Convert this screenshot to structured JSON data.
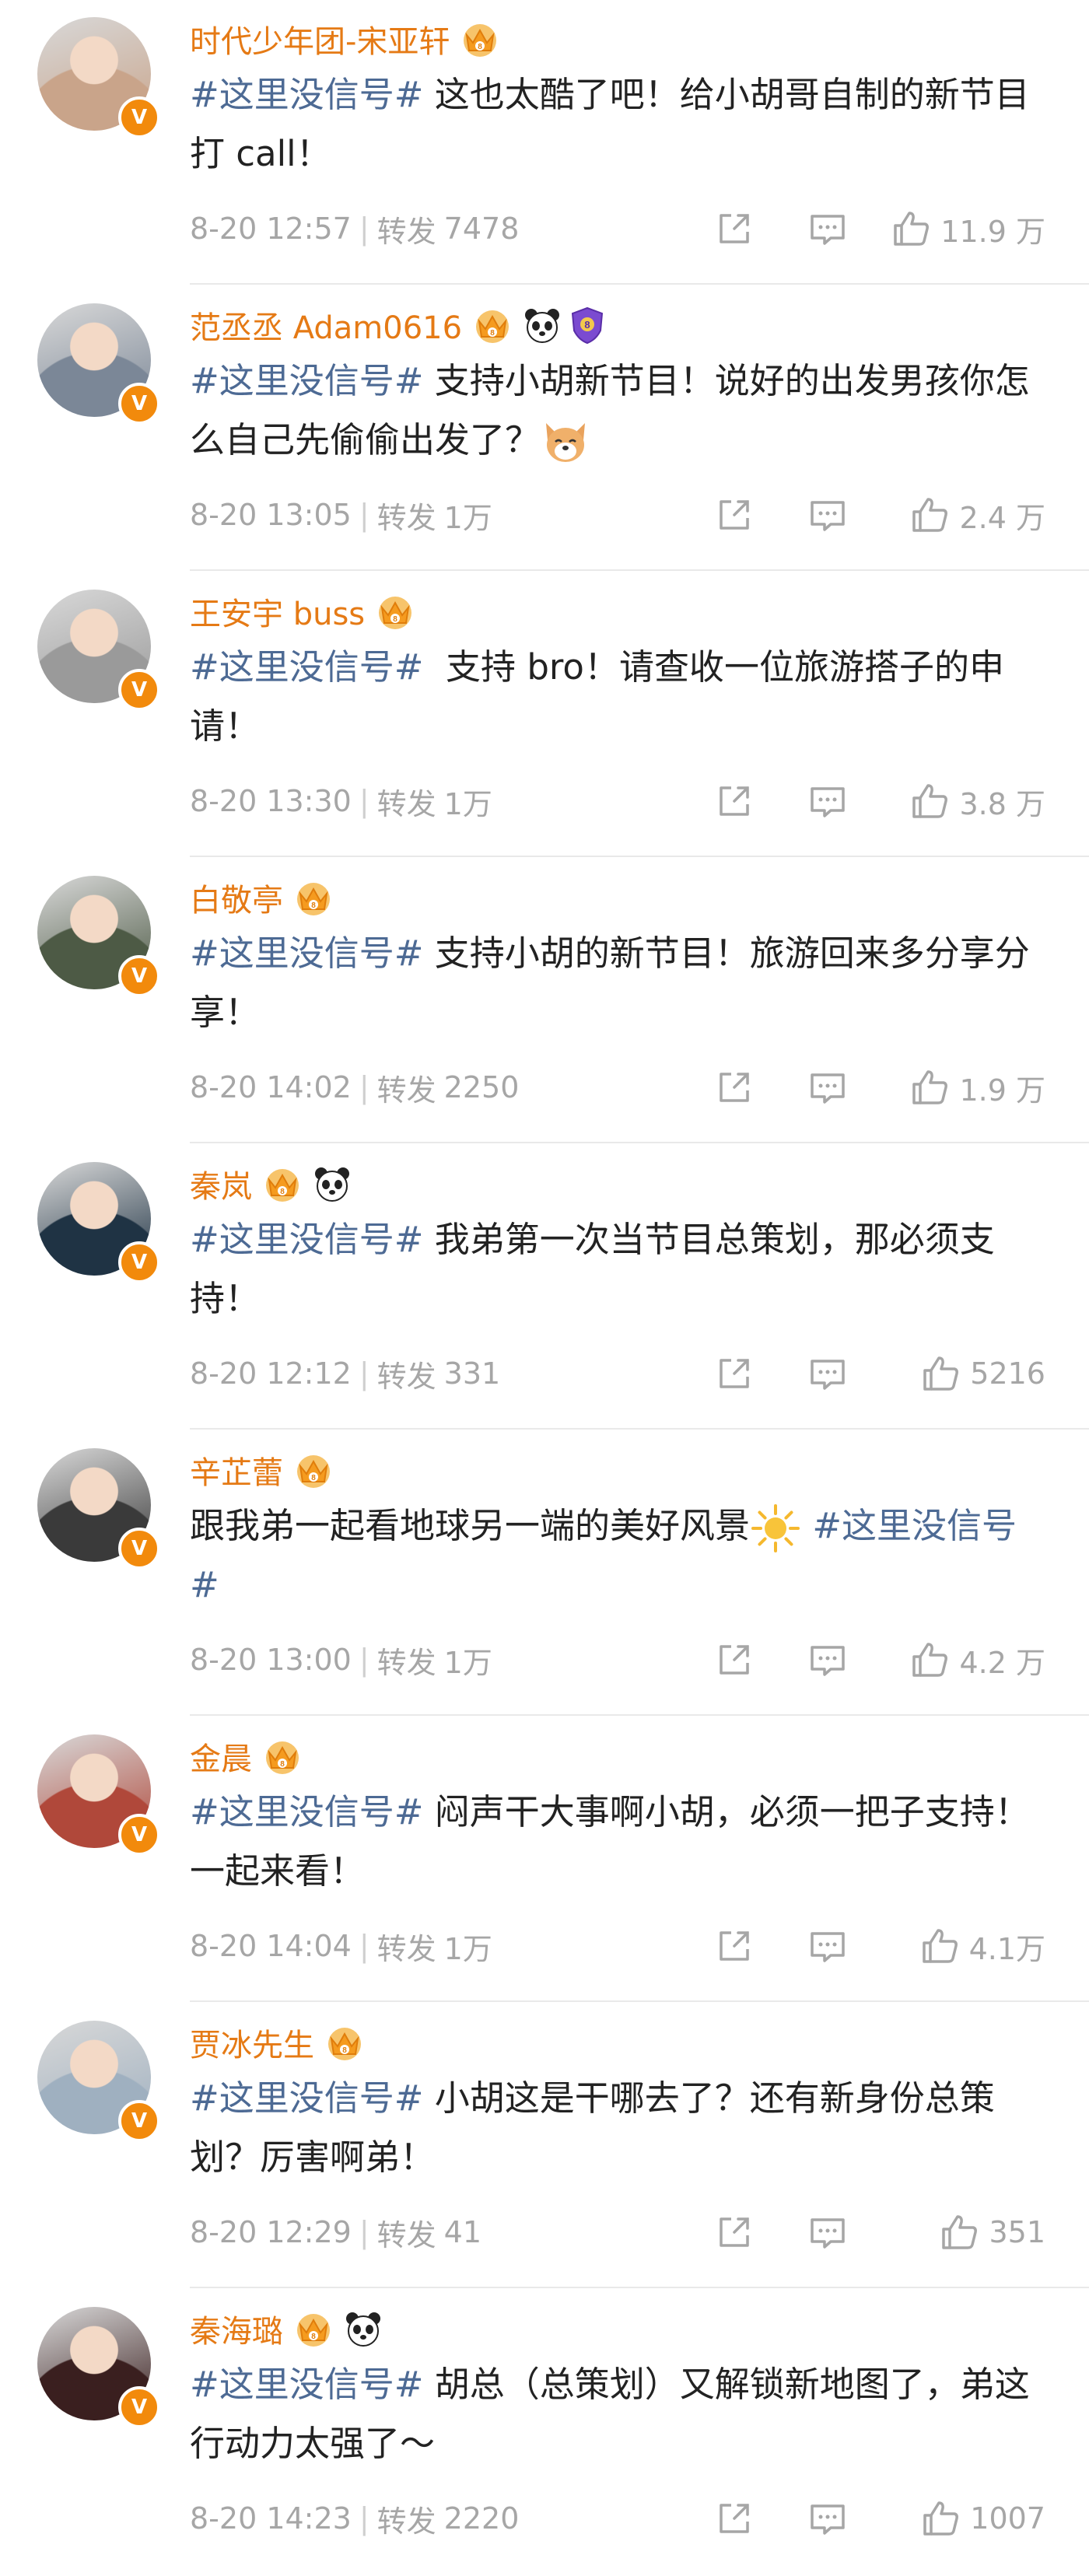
{
  "posts": [
    {
      "name": "时代少年团-宋亚轩",
      "badges": [
        "crown"
      ],
      "topic": "#这里没信号#",
      "body": " 这也太酷了吧！给小胡哥自制的新节目打 call！",
      "time": "8-20 12:57",
      "repost_label": "转发",
      "repost_count": "7478",
      "likes": "11.9 万",
      "avatar_color": "#c9a48a"
    },
    {
      "name": "范丞丞 Adam0616",
      "badges": [
        "crown",
        "panda",
        "shield"
      ],
      "topic": "#这里没信号#",
      "body": " 支持小胡新节目！说好的出发男孩你怎么自己先偷偷出发了？",
      "emoji": "dog",
      "time": "8-20 13:05",
      "repost_label": "转发",
      "repost_count": "1万",
      "likes": "2.4 万",
      "avatar_color": "#7b8797"
    },
    {
      "name": "王安宇 buss",
      "badges": [
        "crown"
      ],
      "topic": "#这里没信号#",
      "body": "  支持 bro！请查收一位旅游搭子的申请！",
      "time": "8-20 13:30",
      "repost_label": "转发",
      "repost_count": "1万",
      "likes": "3.8 万",
      "avatar_color": "#9a9a9a"
    },
    {
      "name": "白敬亭",
      "badges": [
        "crown"
      ],
      "topic": "#这里没信号#",
      "body": " 支持小胡的新节目！旅游回来多分享分享！",
      "time": "8-20 14:02",
      "repost_label": "转发",
      "repost_count": "2250",
      "likes": "1.9 万",
      "avatar_color": "#4d5a45"
    },
    {
      "name": "秦岚",
      "badges": [
        "crown",
        "panda"
      ],
      "topic": "#这里没信号#",
      "body": " 我弟第一次当节目总策划，那必须支持！",
      "time": "8-20 12:12",
      "repost_label": "转发",
      "repost_count": "331",
      "likes": "5216",
      "avatar_color": "#1f3344"
    },
    {
      "name": "辛芷蕾",
      "badges": [
        "crown"
      ],
      "topic_first": false,
      "lead": "跟我弟一起看地球另一端的美好风景",
      "emoji": "sun",
      "topic": " #这里没信号#",
      "time": "8-20 13:00",
      "repost_label": "转发",
      "repost_count": "1万",
      "likes": "4.2 万",
      "avatar_color": "#3a3a3a"
    },
    {
      "name": "金晨",
      "badges": [
        "crown"
      ],
      "topic": "#这里没信号#",
      "body": " 闷声干大事啊小胡，必须一把子支持！一起来看！",
      "time": "8-20 14:04",
      "repost_label": "转发",
      "repost_count": "1万",
      "likes": "4.1万",
      "avatar_color": "#b0483a"
    },
    {
      "name": "贾冰先生",
      "badges": [
        "crown"
      ],
      "topic": "#这里没信号#",
      "body": " 小胡这是干哪去了？还有新身份总策划？厉害啊弟！",
      "time": "8-20 12:29",
      "repost_label": "转发",
      "repost_count": "41",
      "likes": "351",
      "avatar_color": "#9fb0c0"
    },
    {
      "name": "秦海璐",
      "badges": [
        "crown",
        "panda"
      ],
      "topic": "#这里没信号#",
      "body": " 胡总（总策划）又解锁新地图了，弟这行动力太强了～",
      "time": "8-20 14:23",
      "repost_label": "转发",
      "repost_count": "2220",
      "likes": "1007",
      "avatar_color": "#3a1f1f"
    }
  ],
  "colors": {
    "name": "#e57a15",
    "topic": "#4d6a94",
    "meta": "#a6a6a6",
    "verified": "#f28a0c"
  },
  "icons": [
    "share-icon",
    "comment-icon",
    "like-icon",
    "verified-icon",
    "crown-badge-icon",
    "panda-badge-icon",
    "shield-badge-icon"
  ]
}
